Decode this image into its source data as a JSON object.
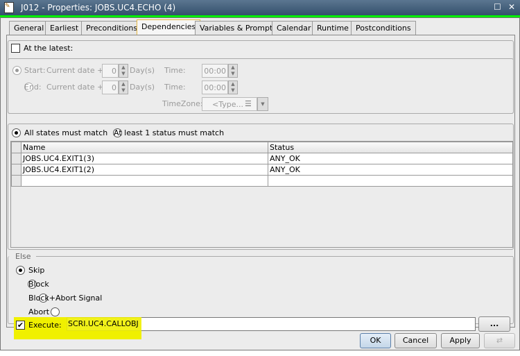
{
  "window": {
    "title": "J012 - Properties: JOBS.UC4.ECHO (4)"
  },
  "tabs": [
    "General",
    "Earliest",
    "Preconditions",
    "Dependencies",
    "Variables & Prompts",
    "Calendar",
    "Runtime",
    "Postconditions"
  ],
  "latest": {
    "label": "At the latest:",
    "checked": false,
    "start_label": "Start:",
    "end_label": "End:",
    "current_date": "Current date +",
    "start_days": "0",
    "end_days": "0",
    "days_label": "Day(s)",
    "time_label": "Time:",
    "start_time": "00:00",
    "end_time": "00:00",
    "timezone_label": "TimeZone:",
    "timezone_value": "<Type..."
  },
  "match": {
    "all": "All states must match",
    "one": "At least 1 status must match"
  },
  "table": {
    "columns": [
      "Name",
      "Status"
    ],
    "rows": [
      [
        "JOBS.UC4.EXIT1(3)",
        "ANY_OK"
      ],
      [
        "JOBS.UC4.EXIT1(2)",
        "ANY_OK"
      ]
    ]
  },
  "else": {
    "title": "Else",
    "options": [
      "Skip",
      "Block",
      "Block+Abort Signal",
      "Abort"
    ],
    "execute_label": "Execute:",
    "execute_value": "SCRI.UC4.CALLOBJ",
    "browse": "..."
  },
  "buttons": {
    "ok": "OK",
    "cancel": "Cancel",
    "apply": "Apply"
  },
  "colors": {
    "highlight": "#ffff00",
    "accent": "#00ee00"
  }
}
